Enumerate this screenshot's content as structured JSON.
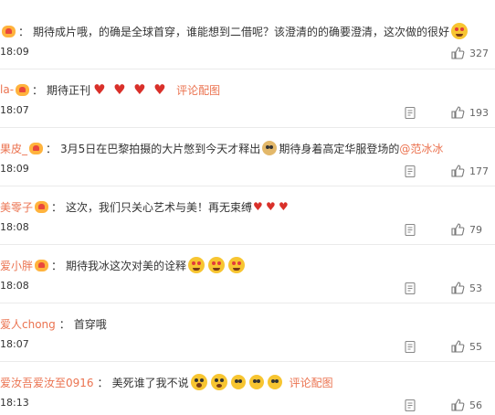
{
  "comments": [
    {
      "user": "",
      "text": "期待成片哦，的确是全球首穿，谁能想到二借呢？该澄清的的确要澄清，这次做的很好",
      "time": "18:09",
      "likes": "327"
    },
    {
      "user": "la-",
      "text": "期待正刊",
      "link": "评论配图",
      "time": "18:07",
      "likes": "193"
    },
    {
      "user": "果皮_",
      "text": "3月5日在巴黎拍摄的大片憋到今天才释出",
      "text2": "期待身着高定华服登场的",
      "mention": "@范冰冰",
      "time": "18:09",
      "likes": "177"
    },
    {
      "user": "美零子",
      "text": "这次，我们只关心艺术与美！再无束缚",
      "time": "18:08",
      "likes": "79"
    },
    {
      "user": "爱小胖",
      "text": "期待我冰这次对美的诠释",
      "time": "18:08",
      "likes": "53"
    },
    {
      "user": "爱人chong",
      "text": "首穿哦",
      "time": "18:07",
      "likes": "55"
    },
    {
      "user": "爱汝吾爱汝至0916",
      "text": "美死谁了我不说",
      "link": "评论配图",
      "time": "18:13",
      "likes": "56"
    }
  ],
  "colors": {
    "username": "#eb7350",
    "text": "#333333",
    "meta": "#666666"
  },
  "icons": {
    "report": "clipboard-icon",
    "like": "thumbs-up-icon"
  }
}
